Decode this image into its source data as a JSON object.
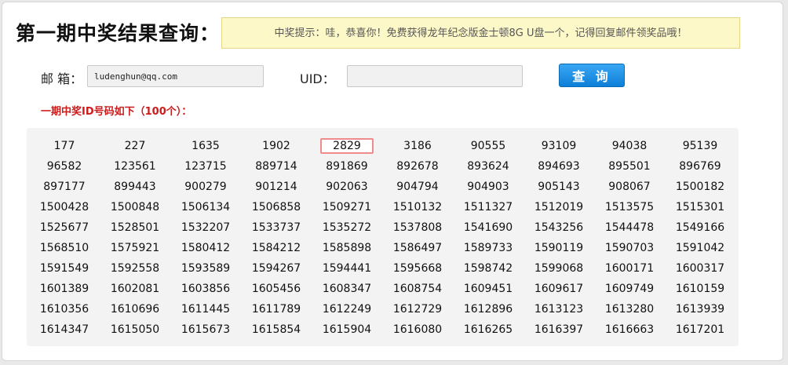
{
  "header": {
    "title": "第一期中奖结果查询：",
    "notice": "中奖提示：哇，恭喜你！免费获得龙年纪念版金士顿8G U盘一个，记得回复邮件领奖品哦！"
  },
  "form": {
    "email_label": "邮 箱：",
    "email_value": "ludenghun@qq.com",
    "uid_label": "UID：",
    "uid_value": "",
    "query_button": "查 询"
  },
  "winners": {
    "heading": "一期中奖ID号码如下（100个）：",
    "highlighted": "2829",
    "ids": [
      "177",
      "227",
      "1635",
      "1902",
      "2829",
      "3186",
      "90555",
      "93109",
      "94038",
      "95139",
      "96582",
      "123561",
      "123715",
      "889714",
      "891869",
      "892678",
      "893624",
      "894693",
      "895501",
      "896769",
      "897177",
      "899443",
      "900279",
      "901214",
      "902063",
      "904794",
      "904903",
      "905143",
      "908067",
      "1500182",
      "1500428",
      "1500848",
      "1506134",
      "1506858",
      "1509271",
      "1510132",
      "1511327",
      "1512019",
      "1513575",
      "1515301",
      "1525677",
      "1528501",
      "1532207",
      "1533737",
      "1535272",
      "1537808",
      "1541690",
      "1543256",
      "1544478",
      "1549166",
      "1568510",
      "1575921",
      "1580412",
      "1584212",
      "1585898",
      "1586497",
      "1589733",
      "1590119",
      "1590703",
      "1591042",
      "1591549",
      "1592558",
      "1593589",
      "1594267",
      "1594441",
      "1595668",
      "1598742",
      "1599068",
      "1600171",
      "1600317",
      "1601389",
      "1602081",
      "1603856",
      "1605456",
      "1608347",
      "1608754",
      "1609451",
      "1609617",
      "1609749",
      "1610159",
      "1610356",
      "1610696",
      "1611445",
      "1611789",
      "1612249",
      "1612729",
      "1612896",
      "1613123",
      "1613280",
      "1613939",
      "1614347",
      "1615050",
      "1615673",
      "1615854",
      "1615904",
      "1616080",
      "1616265",
      "1616397",
      "1616663",
      "1617201"
    ]
  }
}
